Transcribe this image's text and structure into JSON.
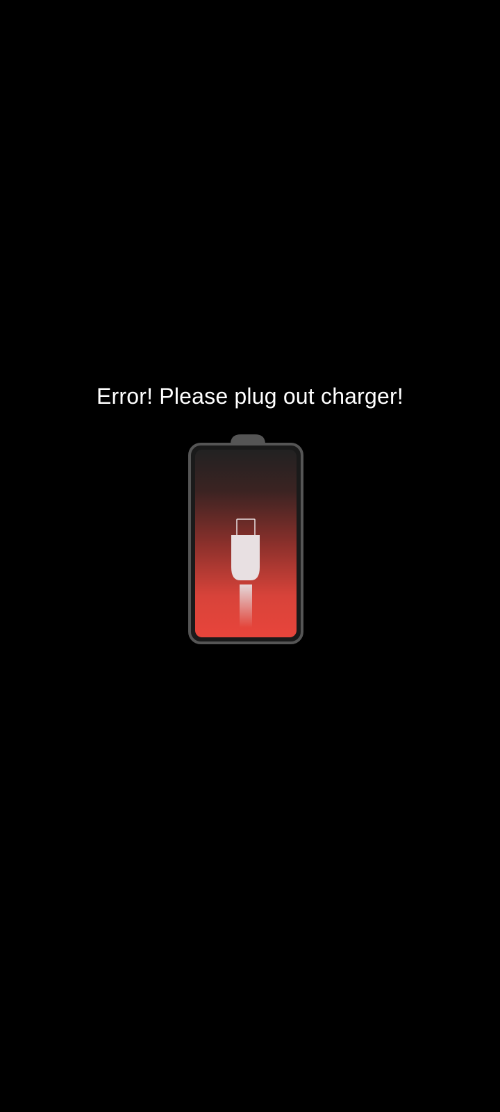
{
  "screen": {
    "background_color": "#000000",
    "error_message": "Error! Please plug out charger!",
    "text_color": "#ffffff"
  },
  "battery": {
    "icon": "battery-charging-error-icon",
    "frame_color": "#555555",
    "gradient_top_color": "#222222",
    "gradient_bottom_color": "#e8453b",
    "plug_icon": "usb-c-plug-icon",
    "plug_color": "#e8e0e2"
  }
}
